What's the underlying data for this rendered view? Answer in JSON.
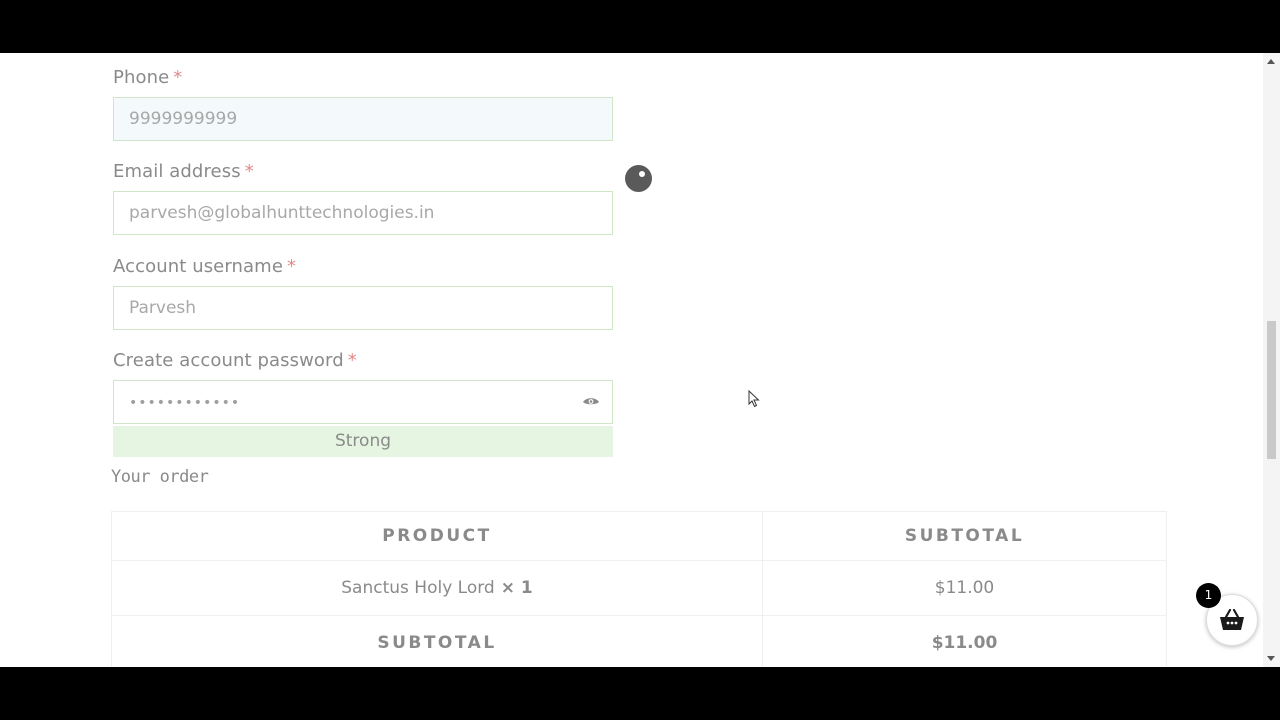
{
  "form": {
    "phone": {
      "label": "Phone",
      "required": "*",
      "value": "9999999999"
    },
    "email": {
      "label": "Email address",
      "required": "*",
      "value": "parvesh@globalhunttechnologies.in"
    },
    "username": {
      "label": "Account username",
      "required": "*",
      "value": "Parvesh"
    },
    "password": {
      "label": "Create account password",
      "required": "*",
      "masked_value": "••••••••••••",
      "strength": "Strong",
      "toggle_icon": "eye-icon"
    }
  },
  "order": {
    "heading": "Your order",
    "columns": [
      "PRODUCT",
      "SUBTOTAL"
    ],
    "items": [
      {
        "name": "Sanctus Holy Lord",
        "qty": "× 1",
        "subtotal": "$11.00"
      }
    ],
    "subtotal_label": "SUBTOTAL",
    "subtotal_value": "$11.00"
  },
  "cart": {
    "badge_count": "1",
    "icon": "basket-icon"
  },
  "colors": {
    "required_asterisk": "#e08a8a",
    "input_border": "#cfe6c8",
    "strength_bg": "#e6f4e2",
    "price": "#efcf8a"
  }
}
